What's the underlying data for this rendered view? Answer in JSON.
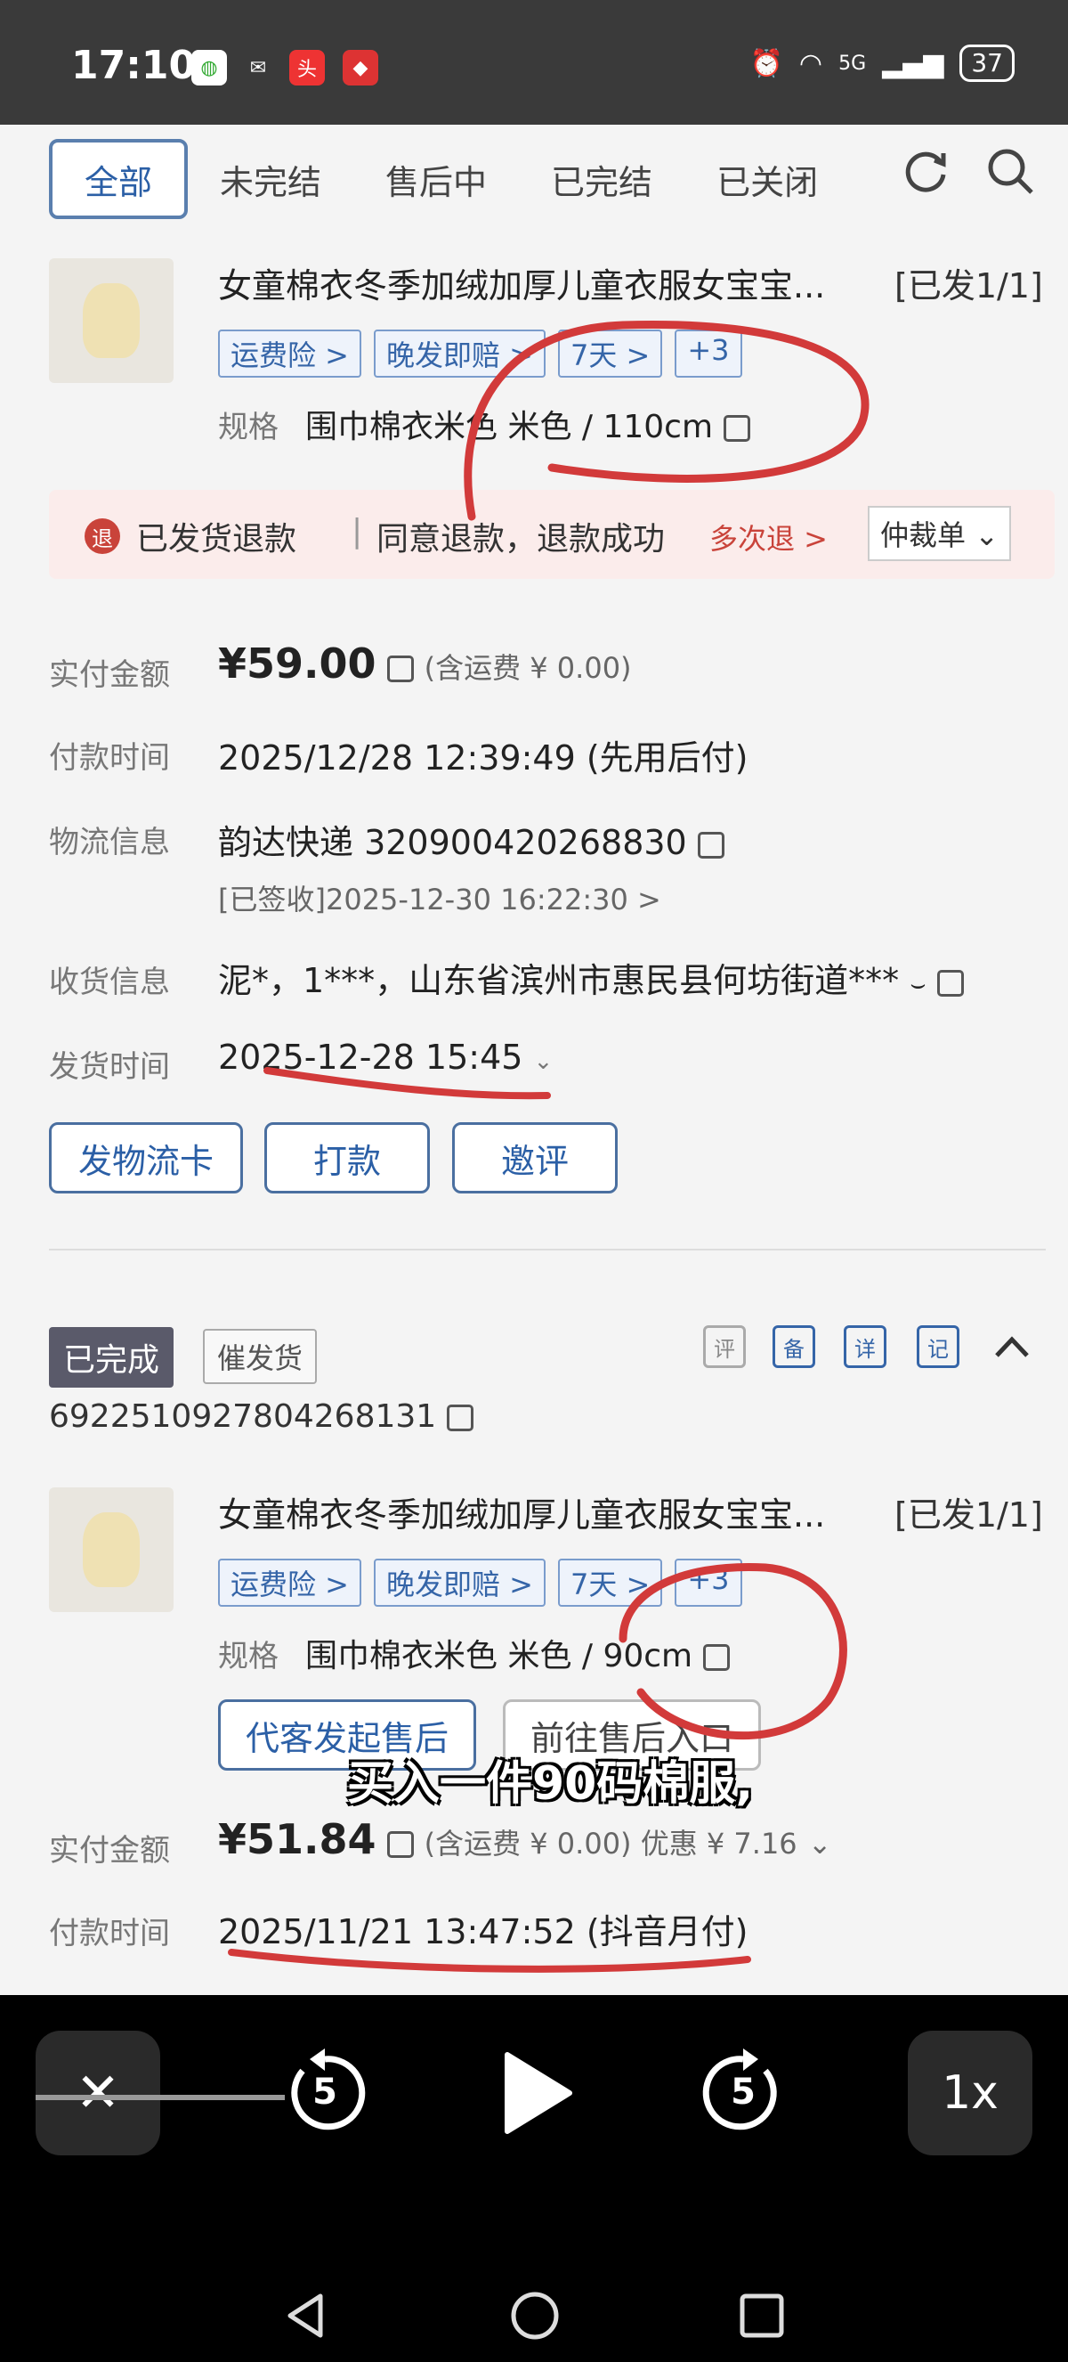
{
  "status": {
    "time": "17:10",
    "battery": "37",
    "net": "5G"
  },
  "tabs": [
    "全部",
    "未完结",
    "售后中",
    "已完结",
    "已关闭"
  ],
  "order1": {
    "title": "女童棉衣冬季加绒加厚儿童衣服女宝宝...",
    "shipped": "[已发1/1]",
    "tags": [
      "运费险 >",
      "晚发即赔 >",
      "7天 >",
      "+3"
    ],
    "spec_label": "规格",
    "spec_value": "围巾棉衣米色 米色 / 110cm",
    "refund": {
      "icon": "退",
      "status": "已发货退款",
      "result": "同意退款，退款成功",
      "multi": "多次退 >",
      "arb": "仲裁单"
    },
    "paid_label": "实付金额",
    "paid_value": "¥59.00",
    "paid_note": "(含运费 ¥ 0.00)",
    "pay_time_label": "付款时间",
    "pay_time": "2025/12/28 12:39:49 (先用后付)",
    "logistics_label": "物流信息",
    "logistics": "韵达快递 320900420268830",
    "signed": "[已签收]2025-12-30 16:22:30 >",
    "receiver_label": "收货信息",
    "receiver": "泥*，1***，山东省滨州市惠民县何坊街道***",
    "ship_time_label": "发货时间",
    "ship_time": "2025-12-28 15:45",
    "buttons": [
      "发物流卡",
      "打款",
      "邀评"
    ]
  },
  "order2": {
    "status": "已完成",
    "urge": "催发货",
    "icons": [
      "评",
      "备",
      "详",
      "记"
    ],
    "order_no": "6922510927804268131",
    "title": "女童棉衣冬季加绒加厚儿童衣服女宝宝...",
    "shipped": "[已发1/1]",
    "tags": [
      "运费险 >",
      "晚发即赔 >",
      "7天 >",
      "+3"
    ],
    "spec_label": "规格",
    "spec_value": "围巾棉衣米色 米色 / 90cm",
    "action_btn": "代客发起售后",
    "action_btn2": "前往售后入口",
    "paid_label": "实付金额",
    "paid_value": "¥51.84",
    "paid_note": "(含运费 ¥ 0.00) 优惠 ¥ 7.16",
    "pay_time_label": "付款时间",
    "pay_time": "2025/11/21 13:47:52 (抖音月付)"
  },
  "subtitle": "买入一件90码棉服,",
  "player": {
    "speed": "1x",
    "rewind": "5",
    "forward": "5"
  }
}
